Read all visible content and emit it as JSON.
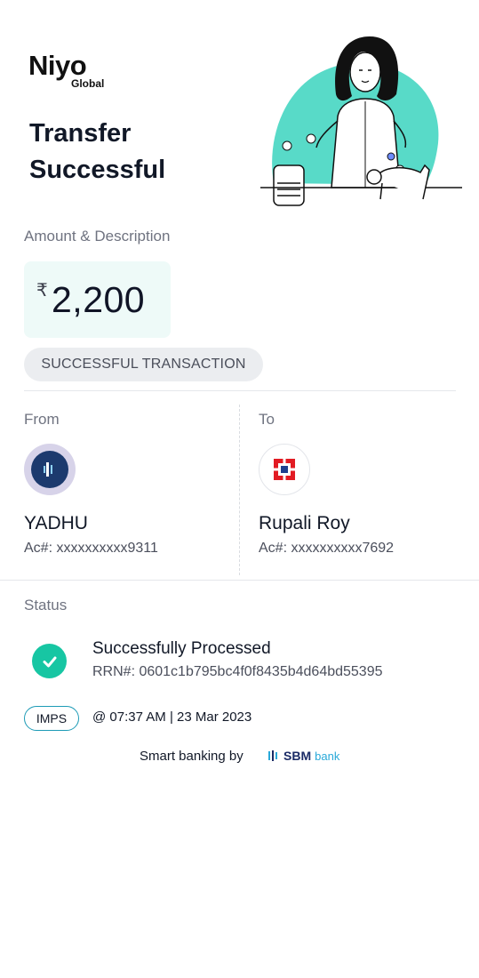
{
  "brand": {
    "name": "Niyo",
    "sub": "Global"
  },
  "title": "Transfer Successful",
  "amount_section": {
    "label": "Amount & Description",
    "currency_symbol": "₹",
    "amount": "2,200",
    "status_pill": "SUCCESSFUL TRANSACTION"
  },
  "from": {
    "label": "From",
    "name": "YADHU",
    "account": "Ac#: xxxxxxxxxx9311",
    "avatar_icon": "bank-logo-icon"
  },
  "to": {
    "label": "To",
    "name": "Rupali Roy",
    "account": "Ac#: xxxxxxxxxx7692",
    "avatar_icon": "hdfc-bank-logo-icon"
  },
  "status": {
    "label": "Status",
    "title": "Successfully Processed",
    "rrn": "RRN#: 0601c1b795bc4f0f8435b4d64bd55395",
    "mode": "IMPS",
    "time": "@ 07:37 AM | 23 Mar 2023"
  },
  "footer": {
    "text": "Smart banking by",
    "partner": "SBM",
    "partner_sub": "bank"
  },
  "colors": {
    "accent": "#17c6a3",
    "amount_bg": "#eefaf8",
    "pill_bg": "#ebedf0"
  }
}
